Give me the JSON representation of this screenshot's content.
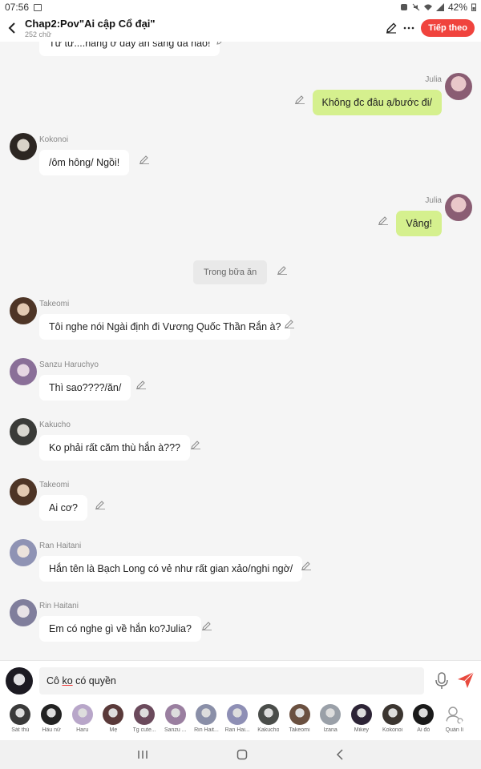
{
  "status_bar": {
    "time": "07:56",
    "battery": "42%"
  },
  "header": {
    "title": "Chap2:Pov\"Ai cập Cổ đại\"",
    "subtitle": "252 chữ",
    "next_label": "Tiếp theo"
  },
  "messages": [
    {
      "text": "Từ từ....nàng ở đây ăn sáng đã nào!"
    },
    {
      "speaker": "Julia",
      "text": "Không đc đâu ạ/bước đi/"
    },
    {
      "speaker": "Kokonoi",
      "text": "/ôm hông/ Ngồi!"
    },
    {
      "speaker": "Julia",
      "text": "Vâng!"
    },
    {
      "text": "Trong bữa ăn"
    },
    {
      "speaker": "Takeomi",
      "text": "Tôi nghe nói Ngài định đi Vương Quốc Thần Rắn à?"
    },
    {
      "speaker": "Sanzu Haruchyo",
      "text": "Thì sao????/ăn/"
    },
    {
      "speaker": "Kakucho",
      "text": "Ko phải rất căm thù hắn à???"
    },
    {
      "speaker": "Takeomi",
      "text": "Ai cơ?"
    },
    {
      "speaker": "Ran Haitani",
      "text": "Hắn tên là Bạch Long có vẻ như rất gian xảo/nghi ngờ/"
    },
    {
      "speaker": "Rin Haitani",
      "text": "Em có nghe gì về hắn ko?Julia?"
    }
  ],
  "input": {
    "before": "Cô ",
    "underlined": "ko",
    "after": " có quyền"
  },
  "characters": [
    {
      "label": "Sát thủ",
      "color": "#3a3a3a"
    },
    {
      "label": "Hầu nữ",
      "color": "#222222"
    },
    {
      "label": "Haru",
      "color": "#b8a6c9"
    },
    {
      "label": "Mẹ",
      "color": "#5a3a3a"
    },
    {
      "label": "Tg cute...",
      "color": "#6b4a5c"
    },
    {
      "label": "Sanzu ...",
      "color": "#9a7fa0"
    },
    {
      "label": "Rin Hait...",
      "color": "#8a8fa8"
    },
    {
      "label": "Ran Hai...",
      "color": "#8e8fb5"
    },
    {
      "label": "Kakucho",
      "color": "#4a4d4a"
    },
    {
      "label": "Takeomi",
      "color": "#6a5040"
    },
    {
      "label": "Izana",
      "color": "#9aa0a8"
    },
    {
      "label": "Mikey",
      "color": "#2d2436"
    },
    {
      "label": "Kokonoi",
      "color": "#3b3530"
    },
    {
      "label": "Ai đó",
      "color": "#1a1a1a"
    },
    {
      "label": "Quản lí",
      "color": "#ffffff"
    }
  ]
}
